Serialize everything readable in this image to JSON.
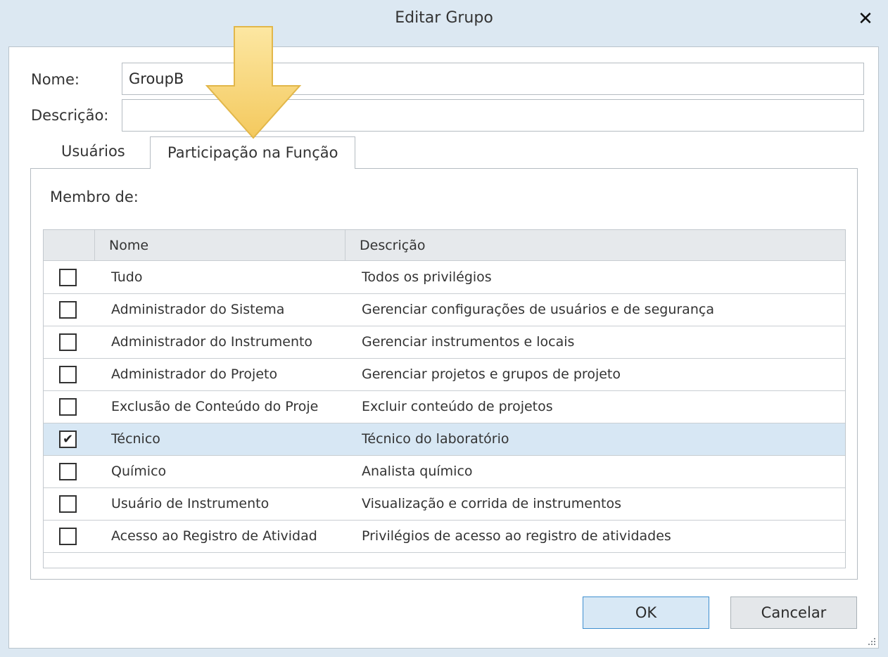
{
  "window": {
    "title": "Editar Grupo",
    "close_glyph": "✕"
  },
  "form": {
    "name_label": "Nome:",
    "name_value": "GroupB",
    "description_label": "Descrição:",
    "description_value": ""
  },
  "tabs": [
    {
      "label": "Usuários",
      "active": false
    },
    {
      "label": "Participação na Função",
      "active": true
    }
  ],
  "membership": {
    "heading": "Membro de:",
    "columns": [
      "Nome",
      "Descrição"
    ],
    "rows": [
      {
        "name": "Tudo",
        "description": "Todos os privilégios",
        "checked": false
      },
      {
        "name": "Administrador do Sistema",
        "description": "Gerenciar configurações de usuários e de segurança",
        "checked": false
      },
      {
        "name": "Administrador do Instrumento",
        "description": "Gerenciar instrumentos e locais",
        "checked": false
      },
      {
        "name": "Administrador do Projeto",
        "description": "Gerenciar projetos e grupos de projeto",
        "checked": false
      },
      {
        "name": "Exclusão de Conteúdo do Proje",
        "description": "Excluir conteúdo de projetos",
        "checked": false
      },
      {
        "name": "Técnico",
        "description": "Técnico do laboratório",
        "checked": true
      },
      {
        "name": "Químico",
        "description": "Analista químico",
        "checked": false
      },
      {
        "name": "Usuário de Instrumento",
        "description": "Visualização e corrida de instrumentos",
        "checked": false
      },
      {
        "name": "Acesso ao Registro de Atividad",
        "description": "Privilégios de acesso ao registro de atividades",
        "checked": false
      }
    ]
  },
  "buttons": {
    "ok": "OK",
    "cancel": "Cancelar"
  },
  "annotation": {
    "icon": "callout-arrow-down-icon",
    "color": "#f9d77a"
  },
  "colors": {
    "selected_row": "#d7e7f4",
    "ok_border": "#3f8fd0"
  }
}
